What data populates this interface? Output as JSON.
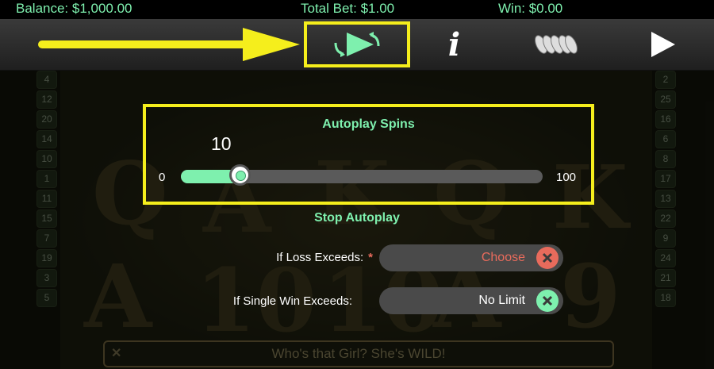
{
  "status": {
    "balance": "Balance: $1,000.00",
    "total_bet": "Total Bet: $1.00",
    "win": "Win: $0.00"
  },
  "toolbar": {
    "icons": [
      "back-arrow-icon",
      "autoplay-icon",
      "info-icon",
      "coins-icon",
      "play-icon"
    ],
    "info_glyph": "i"
  },
  "reel_numbers": {
    "left": [
      "4",
      "12",
      "20",
      "14",
      "10",
      "1",
      "11",
      "15",
      "7",
      "19",
      "3",
      "5"
    ],
    "right": [
      "2",
      "25",
      "16",
      "6",
      "8",
      "17",
      "13",
      "22",
      "9",
      "24",
      "21",
      "18"
    ]
  },
  "autoplay": {
    "title": "Autoplay Spins",
    "value": "10",
    "min": "0",
    "max": "100",
    "fraction": 0.1
  },
  "stop_autoplay": {
    "title": "Stop Autoplay",
    "loss_label": "If Loss Exceeds:",
    "loss_required_mark": "*",
    "loss_value": "Choose",
    "single_win_label": "If Single Win Exceeds:",
    "single_win_value": "No Limit"
  },
  "bottom_message": "Who's that Girl? She's WILD!",
  "colors": {
    "accent": "#7ef0ae",
    "highlight": "#f5ee1c",
    "loss_value": "#e86b5c",
    "clear_red": "#e86b5c",
    "clear_green": "#7ef0ae"
  }
}
